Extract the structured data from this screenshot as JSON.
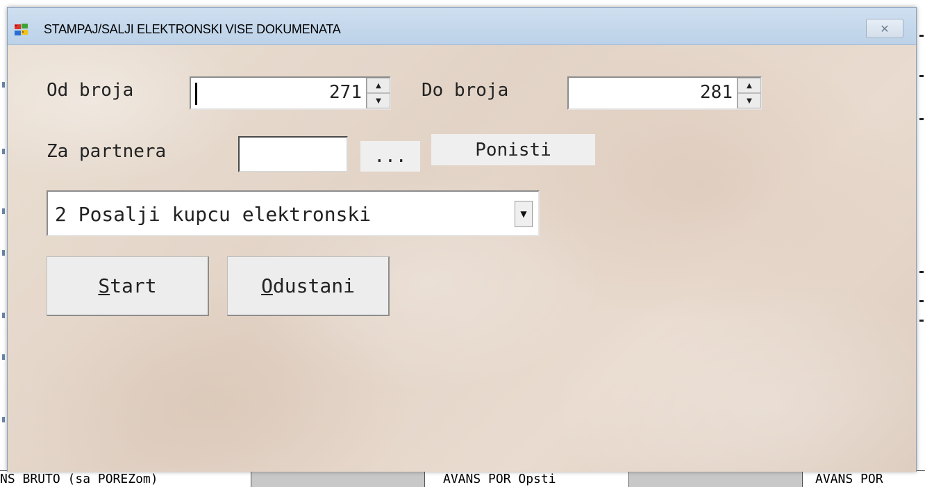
{
  "dialog": {
    "title": "STAMPAJ/SALJI ELEKTRONSKI VISE DOKUMENATA",
    "close_label": "✕",
    "app_icon": "windows-logo-icon"
  },
  "form": {
    "od_broja_label": "Od broja",
    "od_broja_value": "271",
    "do_broja_label": "Do broja",
    "do_broja_value": "281",
    "za_partnera_label": "Za partnera",
    "za_partnera_value": "",
    "browse_label": "...",
    "ponisti_label": "Ponisti",
    "action_selected": "2 Posalji kupcu elektronski",
    "start_hotkey": "S",
    "start_rest": "tart",
    "odustani_hotkey": "O",
    "odustani_rest": "dustani"
  },
  "background_grid": {
    "bottom_cells": [
      "NS BRUTO (sa POREZom)",
      "",
      "AVANS POR Opsti",
      "",
      "AVANS POR"
    ]
  },
  "colors": {
    "dialog_background": "#e9dccf",
    "titlebar": "#c8dbee"
  }
}
